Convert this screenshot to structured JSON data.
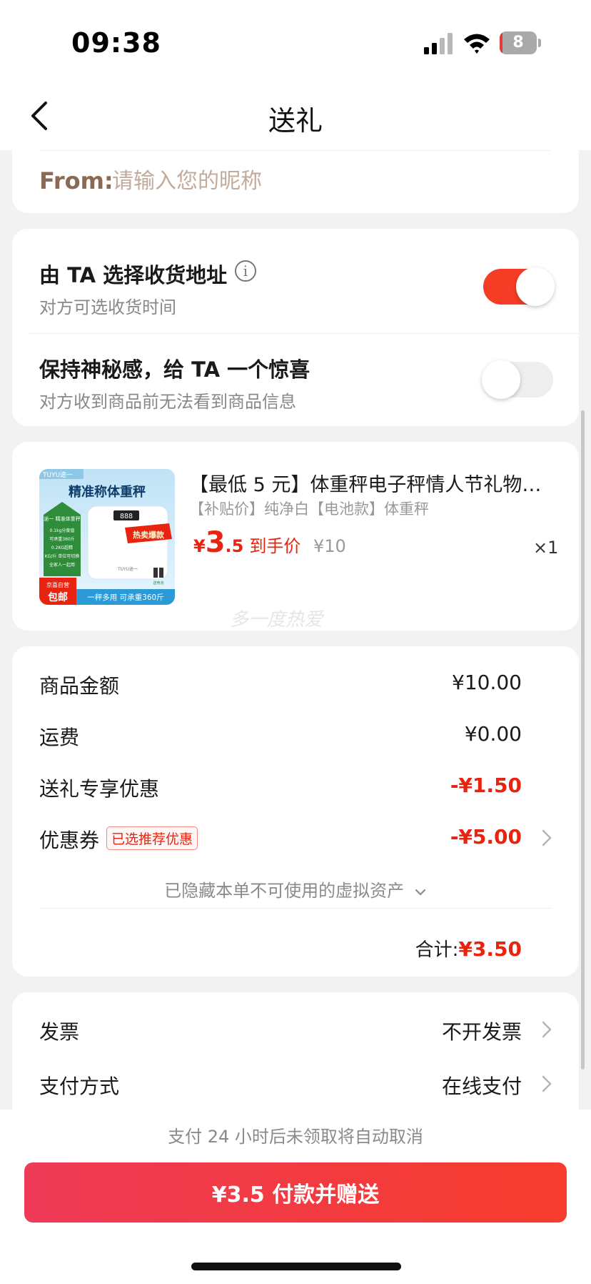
{
  "status_bar": {
    "time": "09:38",
    "battery": "8",
    "battery_level": 0.08
  },
  "nav": {
    "title": "送礼"
  },
  "from_section": {
    "label": "From:",
    "placeholder": "请输入您的昵称"
  },
  "options": [
    {
      "title": "由 TA 选择收货地址",
      "subtitle": "对方可选收货时间",
      "enabled": true
    },
    {
      "title": "保持神秘感，给 TA 一个惊喜",
      "subtitle": "对方收到商品前无法看到商品信息",
      "enabled": false
    }
  ],
  "product": {
    "title": "【最低 5 元】体重秤电子秤情人节礼物男…",
    "spec": "【补贴价】纯净白【电池款】体重秤",
    "price_currency": "¥",
    "price_int": "3",
    "price_dec": ".5",
    "price_label": "到手价",
    "original_price": "¥10",
    "quantity": "×1",
    "image": {
      "brand": "TUYU途一",
      "headline": "精准称体重秤",
      "sub_headline": "途一 精准体重秤",
      "features": [
        "0.1kg分度值",
        "可承重360斤",
        "0.2KG超精",
        "KG/斤 单位可切换",
        "全家人一起用"
      ],
      "display": "888",
      "scale_brand": "TUYU途一",
      "battery_tag": "送电池",
      "hot_badge": "热卖爆款",
      "jd_label": "京喜自营",
      "free_ship": "包邮",
      "bottom_text": "一秤多用 可承重360斤"
    },
    "watermark": "多一度热爱"
  },
  "summary": {
    "rows": [
      {
        "label": "商品金额",
        "value": "¥10.00",
        "highlight": false
      },
      {
        "label": "运费",
        "value": "¥0.00",
        "highlight": false
      },
      {
        "label": "送礼专享优惠",
        "value": "-¥1.50",
        "highlight": true
      },
      {
        "label": "优惠券",
        "value": "-¥5.00",
        "highlight": true,
        "tag": "已选推荐优惠"
      }
    ],
    "hidden_assets": "已隐藏本单不可使用的虚拟资产",
    "total_label": "合计:",
    "total_value": "¥3.50"
  },
  "extra": [
    {
      "label": "发票",
      "value": "不开发票"
    },
    {
      "label": "支付方式",
      "value": "在线支付"
    }
  ],
  "footer": {
    "cancel_note": "支付 24 小时后未领取将自动取消",
    "pay_button": "¥3.5 付款并赠送"
  },
  "colors": {
    "accent": "#e8230f",
    "toggle_on": "#f53c25",
    "from_label": "#8b6a55"
  }
}
